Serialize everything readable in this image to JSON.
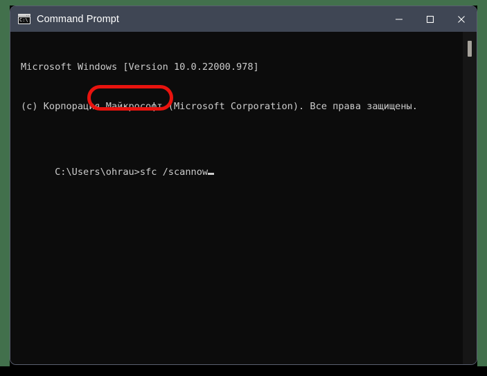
{
  "window": {
    "title": "Command Prompt",
    "icon": "console-icon",
    "icon_text": "C:\\",
    "controls": {
      "minimize": "minimize-button",
      "maximize": "maximize-button",
      "close": "close-button"
    },
    "colors": {
      "titlebar": "#3f4654",
      "terminal_bg": "#0c0c0c",
      "terminal_fg": "#cccccc",
      "desktop": "#42704c",
      "highlight": "#e8130e",
      "border": "#5a6070"
    }
  },
  "terminal": {
    "lines": [
      "Microsoft Windows [Version 10.0.22000.978]",
      "(c) Корпорация Майкрософт (Microsoft Corporation). Все права защищены.",
      "",
      ""
    ],
    "prompt": "C:\\Users\\ohrau>",
    "command": "sfc /scannow",
    "cursor": "block-cursor"
  },
  "annotation": {
    "type": "red-rounded-rect",
    "target": "sfc /scannow"
  },
  "scrollbar": {
    "name": "vertical-scrollbar",
    "thumb": "scrollbar-thumb"
  }
}
